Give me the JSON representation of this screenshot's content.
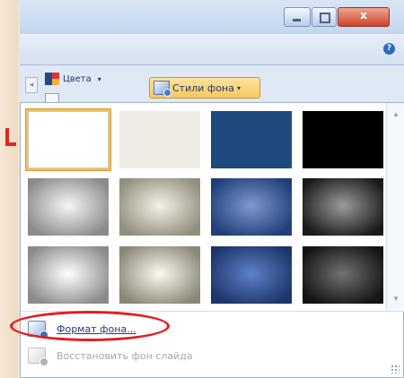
{
  "ribbon": {
    "colors_label": "Цвета",
    "background_styles_label": "Стили фона"
  },
  "window_controls": {
    "close_symbol": "x"
  },
  "gallery": {
    "style_count": 12,
    "selected_index": 0,
    "swatches": [
      {
        "type": "solid",
        "color": "#ffffff"
      },
      {
        "type": "solid",
        "color": "#eeece4"
      },
      {
        "type": "solid",
        "color": "#1f4a7e"
      },
      {
        "type": "solid",
        "color": "#000000"
      },
      {
        "type": "radial",
        "inner": "#f6f6f6",
        "outer": "#8b8b8b"
      },
      {
        "type": "radial",
        "inner": "#f3f1e8",
        "outer": "#928f7e"
      },
      {
        "type": "radial",
        "inner": "#7e99ce",
        "outer": "#213f78"
      },
      {
        "type": "radial",
        "inner": "#9b9b9b",
        "outer": "#1a1a1a"
      },
      {
        "type": "radial",
        "inner": "#ffffff",
        "outer": "#8b8b8b"
      },
      {
        "type": "radial",
        "inner": "#fbfaf2",
        "outer": "#8b8777"
      },
      {
        "type": "radial",
        "inner": "#5f81c9",
        "outer": "#1c356a"
      },
      {
        "type": "radial",
        "inner": "#727272",
        "outer": "#141414"
      }
    ]
  },
  "menu": {
    "format_background": "Формат фона...",
    "reset_slide_background": "Восстановить фон слайда"
  },
  "colors": {
    "highlight_ring": "#e41d1d",
    "selection_border": "#f1c15d",
    "ribbon_button": "#f8c860"
  },
  "icons": {
    "colors": "palette-icon",
    "background_styles": "background-styles-icon",
    "format_background": "format-background-icon",
    "reset_background": "reset-background-icon"
  }
}
